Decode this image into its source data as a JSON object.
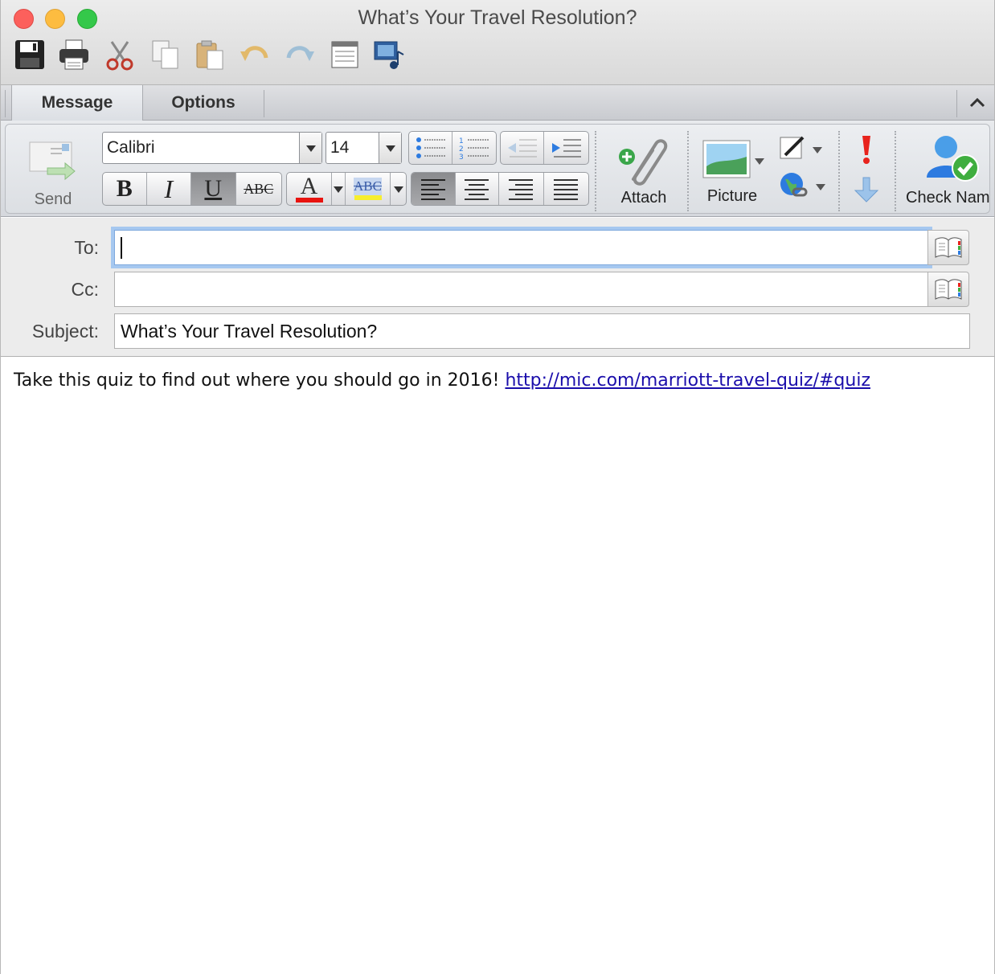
{
  "window": {
    "title": "What’s Your Travel Resolution?"
  },
  "quick_toolbar": {
    "icons": [
      "save-icon",
      "print-icon",
      "cut-icon",
      "copy-icon",
      "paste-icon",
      "undo-icon",
      "redo-icon",
      "layout-icon",
      "media-browser-icon"
    ]
  },
  "tabs": [
    {
      "label": "Message",
      "active": true
    },
    {
      "label": "Options",
      "active": false
    }
  ],
  "ribbon": {
    "send_label": "Send",
    "font_name": "Calibri",
    "font_size": "14",
    "attach_label": "Attach",
    "picture_label": "Picture",
    "check_names_label": "Check Nam",
    "strike_glyph": "ABC",
    "highlight_glyph": "ABC",
    "font_color_glyph": "A",
    "font_color": "#e8130f",
    "highlight_color": "#f6ee2f",
    "bold_glyph": "B",
    "italic_glyph": "I",
    "underline_glyph": "U"
  },
  "fields": {
    "to_label": "To:",
    "to_value": "",
    "cc_label": "Cc:",
    "cc_value": "",
    "subject_label": "Subject:",
    "subject_value": "What’s Your Travel Resolution?"
  },
  "message": {
    "text": "Take this quiz to find out where you should go in 2016! ",
    "link": "http://mic.com/marriott-travel-quiz/#quiz"
  }
}
